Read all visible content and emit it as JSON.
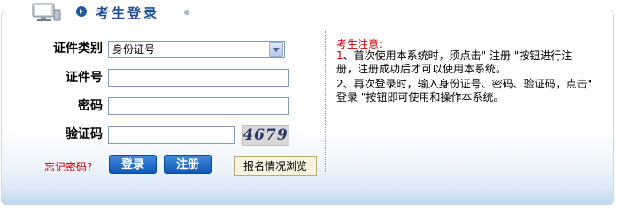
{
  "header": {
    "title": "考生登录"
  },
  "form": {
    "id_type_label": "证件类别",
    "id_type_value": "身份证号",
    "id_number_label": "证件号",
    "password_label": "密码",
    "captcha_label": "验证码",
    "captcha_text": "4679"
  },
  "actions": {
    "forgot_password": "忘记密码?",
    "login_button": "登录",
    "register_button": "注册",
    "browse_button": "报名情况浏览"
  },
  "notice": {
    "title": "考生注意:",
    "items": [
      {
        "num": "1",
        "text": "、首次使用本系统时，须点击\" 注册 \"按钮进行注册，注册成功后才可以使用本系统。"
      },
      {
        "num": "2",
        "text": "、再次登录时，输入身份证号、密码、验证码，点击\" 登录 \"按钮即可使用和操作本系统。"
      }
    ]
  },
  "colors": {
    "title_blue": "#1e4f93",
    "button_blue": "#0f57b5",
    "notice_red": "#cc0000"
  }
}
